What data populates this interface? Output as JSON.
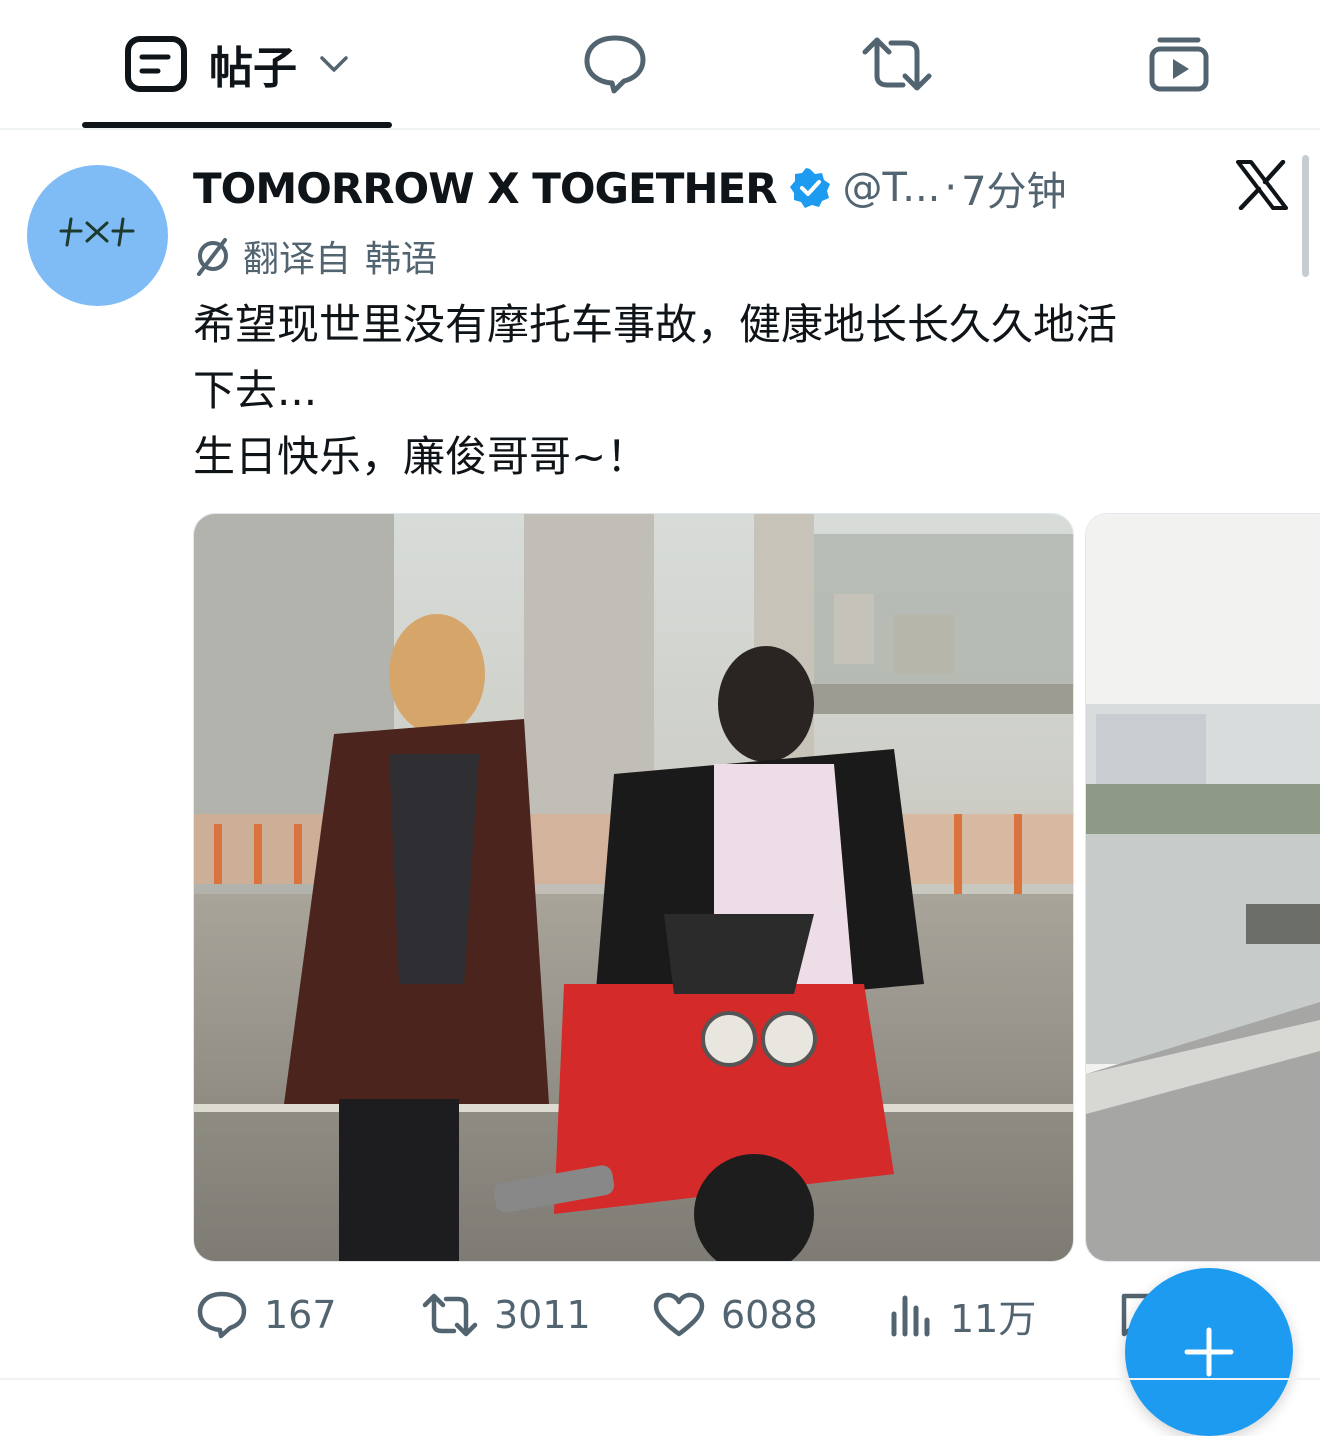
{
  "tabs": {
    "posts": {
      "label": "帖子",
      "icon": "document-icon",
      "dropdown_icon": "chevron-down-icon",
      "selected": true
    },
    "replies": {
      "icon": "speech-bubble-icon"
    },
    "reposts": {
      "icon": "repost-icon"
    },
    "media": {
      "icon": "video-stack-icon"
    }
  },
  "post": {
    "avatar_text": "TXT",
    "display_name": "TOMORROW X TOGETHER",
    "verified": true,
    "handle": "@T...",
    "separator": "·",
    "time": "7分钟",
    "brand_icon": "x-logo-icon",
    "translation": {
      "label": "翻译自",
      "language": "韩语"
    },
    "text": "希望现世里没有摩托车事故，健康地长长久久地活\n下去...\n生日快乐，廉俊哥哥~！",
    "media_count_visible": 2
  },
  "actions": {
    "replies": "167",
    "reposts": "3011",
    "likes": "6088",
    "views": "11万"
  },
  "colors": {
    "accent": "#1d9bf0",
    "avatar_bg": "#7fbcf5",
    "muted_text": "#536471",
    "text": "#0f1419"
  }
}
